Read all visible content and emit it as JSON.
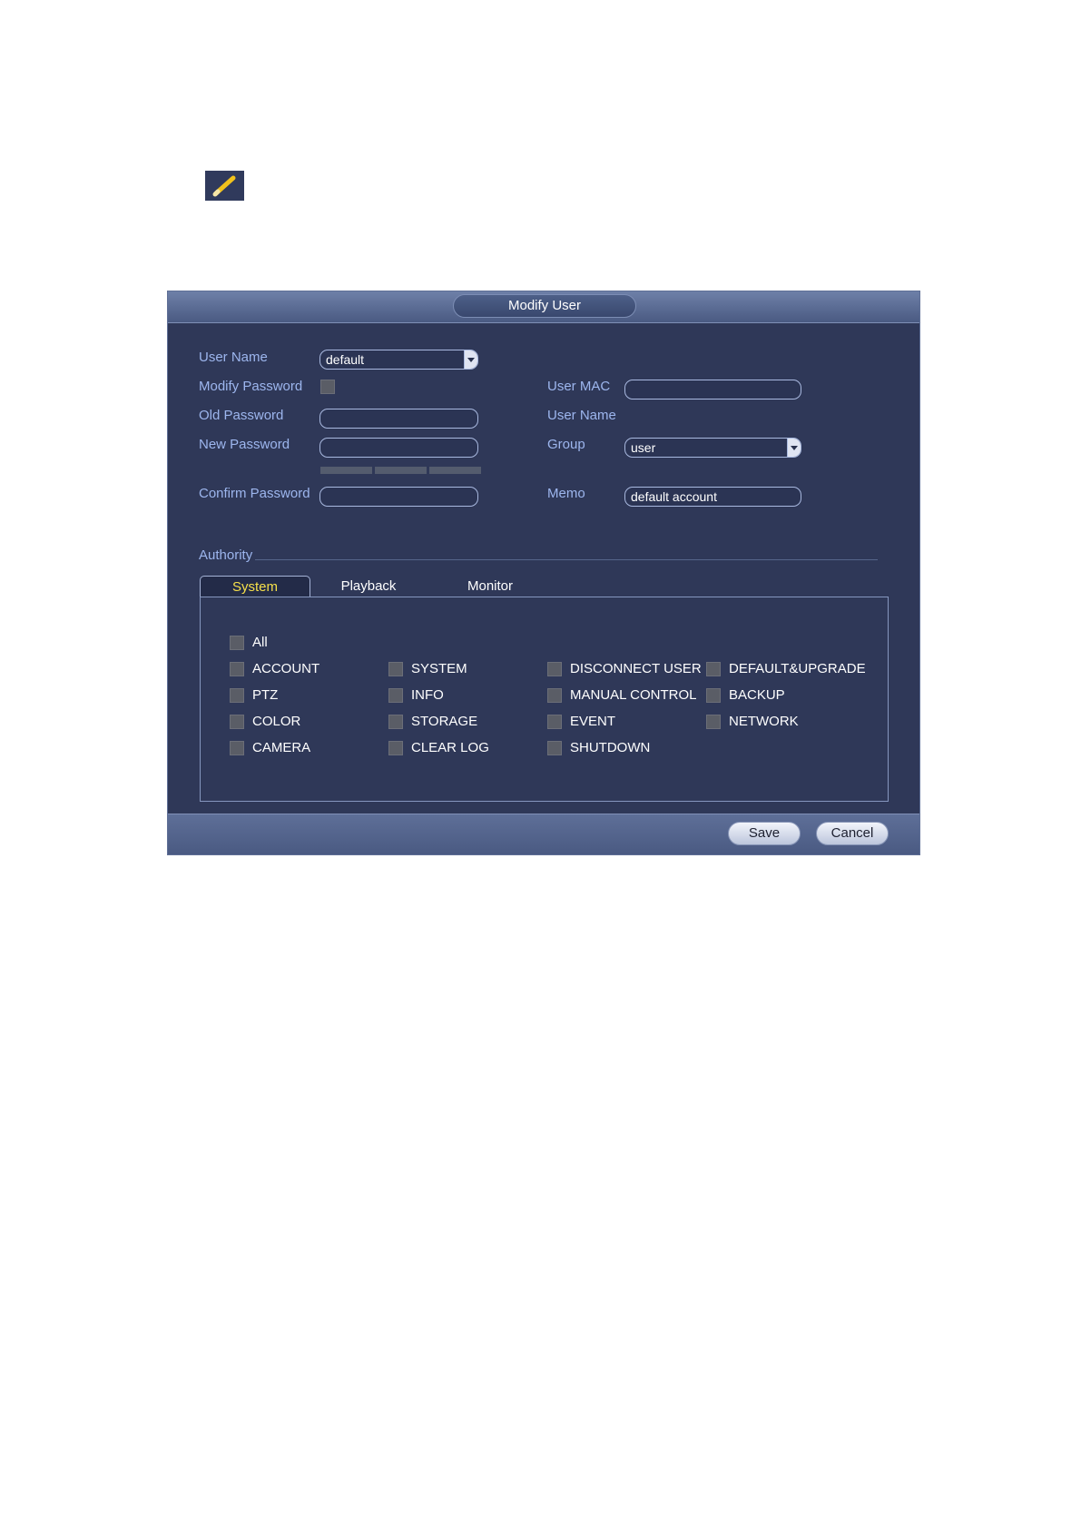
{
  "icon": {
    "name": "pencil-edit-icon"
  },
  "dialog": {
    "title": "Modify User",
    "form": {
      "user_name_label": "User Name",
      "user_name_value": "default",
      "modify_password_label": "Modify Password",
      "old_password_label": "Old Password",
      "new_password_label": "New Password",
      "confirm_password_label": "Confirm Password",
      "user_mac_label": "User MAC",
      "user_name2_label": "User Name",
      "group_label": "Group",
      "group_value": "user",
      "memo_label": "Memo",
      "memo_value": "default account"
    },
    "authority": {
      "label": "Authority",
      "tabs": [
        "System",
        "Playback",
        "Monitor"
      ],
      "active_tab": "System",
      "all_label": "All",
      "permissions": [
        [
          "ACCOUNT",
          "SYSTEM",
          "DISCONNECT USER",
          "DEFAULT&UPGRADE"
        ],
        [
          "PTZ",
          "INFO",
          "MANUAL CONTROL",
          "BACKUP"
        ],
        [
          "COLOR",
          "STORAGE",
          "EVENT",
          "NETWORK"
        ],
        [
          "CAMERA",
          "CLEAR LOG",
          "SHUTDOWN"
        ]
      ]
    },
    "buttons": {
      "save": "Save",
      "cancel": "Cancel"
    }
  },
  "colors": {
    "panel_bg": "#2f3858",
    "label": "#9db6ee",
    "active_tab": "#f6e04a"
  }
}
